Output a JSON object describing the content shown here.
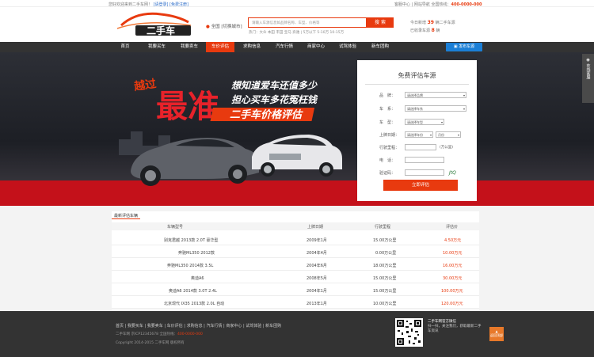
{
  "topbar": {
    "welcome": "您好欢迎来到二手车网！",
    "login": "[请登录]",
    "register": "[免费注册]",
    "hotline_label": "全国热线：",
    "hotline": "400-0000-000",
    "links": "客服中心 | 网站导航"
  },
  "header": {
    "logo_text": "二手车",
    "city": "全国",
    "city_switch": "[切换城市]",
    "search_placeholder": "请输入车源信息如品牌名称、车型、价格等",
    "search_button": "搜 索",
    "hot_words": "热门：大众 本田 丰田 宝马 奔驰 | 5万以下 5-10万 10-15万",
    "stats_line1_prefix": "今日新增",
    "stats_line1_value": "39",
    "stats_line1_suffix": "辆二手车源",
    "stats_line2_prefix": "已收录车源",
    "stats_line2_value": "8",
    "stats_line2_suffix": "辆"
  },
  "nav": {
    "items": [
      {
        "label": "首页"
      },
      {
        "label": "我要买车"
      },
      {
        "label": "我要卖车"
      },
      {
        "label": "车价评估"
      },
      {
        "label": "求购信息"
      },
      {
        "label": "汽车行情"
      },
      {
        "label": "商家中心"
      },
      {
        "label": "试驾体验"
      },
      {
        "label": "新车团购"
      }
    ],
    "active_index": 3,
    "sell_button": "发布车源"
  },
  "banner": {
    "tag1": "越过",
    "tag2": "最准",
    "line1": "想知道爱车还值多少",
    "line2": "担心买车多花冤枉钱",
    "line3": "二手车价格评估"
  },
  "form": {
    "title": "免费评估车源",
    "fields": [
      {
        "label": "品　牌：",
        "value": "请选择品牌"
      },
      {
        "label": "车　系：",
        "value": "请选择车系"
      },
      {
        "label": "车　型：",
        "value": "请选择车型"
      },
      {
        "label": "上牌日期：",
        "value": "请选择年份",
        "value2": "月份"
      },
      {
        "label": "行驶里程：",
        "unit": "(万公里)"
      },
      {
        "label": "电　话："
      },
      {
        "label": "验证码：",
        "captcha": "JtQ"
      }
    ],
    "submit": "立即评估"
  },
  "sidebar": {
    "label": "在线客服"
  },
  "table": {
    "tab": "最新评估车辆",
    "headers": [
      "车辆型号",
      "上牌日期",
      "行驶里程",
      "评估价"
    ],
    "rows": [
      {
        "model": "别克君越 2013款 2.0T 豪华型",
        "date": "2009年1月",
        "mileage": "15.00万公里",
        "price": "4.50万元"
      },
      {
        "model": "奔驰ML350 2012款",
        "date": "2004年4月",
        "mileage": "0.00万公里",
        "price": "10.00万元"
      },
      {
        "model": "奔驰ML350 2014款 3.5L",
        "date": "2004年6月",
        "mileage": "18.00万公里",
        "price": "16.00万元"
      },
      {
        "model": "奥迪A6",
        "date": "2008年5月",
        "mileage": "15.00万公里",
        "price": "30.00万元"
      },
      {
        "model": "奥迪A6 2014款 3.0T 2.4L",
        "date": "2004年1月",
        "mileage": "15.00万公里",
        "price": "100.00万元"
      },
      {
        "model": "北京现代 IX35 2013款 2.0L 自动",
        "date": "2013年1月",
        "mileage": "10.00万公里",
        "price": "120.00万元"
      }
    ]
  },
  "footer": {
    "links": [
      "首页",
      "我要买车",
      "我要卖车",
      "车价评估",
      "求购信息",
      "汽车行情",
      "商家中心",
      "试驾体验",
      "新车团购"
    ],
    "site_label": "二手车网",
    "icp": "京ICP12345678",
    "phone_label": "全国热线：",
    "phone": "400-0000-000",
    "copyright": "Copyright 2014-2015 二手车网 版权所有",
    "qr_title": "二手车网官方微信",
    "qr_desc": "扫一扫，关注我们，获取最新二手车资讯",
    "back_top": "返回顶部"
  },
  "colors": {
    "accent": "#e83a0f",
    "nav_bg": "#333333",
    "banner_red": "#c4111a",
    "blue": "#1b7fd6"
  }
}
